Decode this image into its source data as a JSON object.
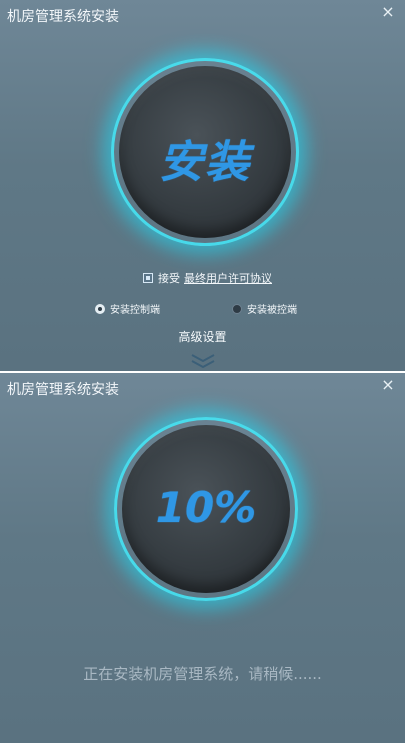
{
  "screen1": {
    "title": "机房管理系统安装",
    "close_icon": "×",
    "install_button": "安装",
    "accept_label": "接受",
    "eula_link": "最终用户许可协议",
    "radio_control_label": "安装控制端",
    "radio_controlled_label": "安装被控端",
    "advanced_settings": "高级设置"
  },
  "screen2": {
    "title": "机房管理系统安装",
    "close_icon": "×",
    "progress_text": "10%",
    "status_text": "正在安装机房管理系统，请稍候......"
  },
  "progress": {
    "value": 0.1
  },
  "colors": {
    "accent": "#2f97e5",
    "glow": "#23d6f0",
    "panel_top": "#6f8797",
    "panel_bottom": "#5a7280"
  },
  "icons": {
    "close": "close-icon",
    "checkbox": "checkbox-checked",
    "expand": "double-chevron-down-icon"
  }
}
